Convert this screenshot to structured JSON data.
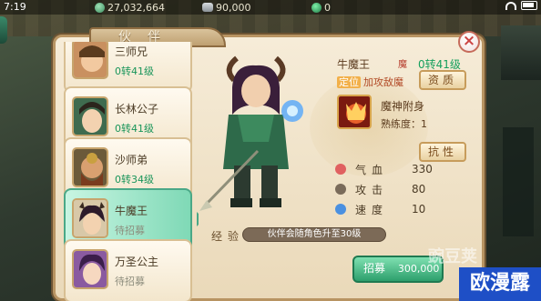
{
  "status_bar": {
    "time": "7:19",
    "gold": "27,032,664",
    "silver": "90,000",
    "jade": "0"
  },
  "panel": {
    "title": "伙伴",
    "close_label": "×"
  },
  "partners": [
    {
      "name": "三师兄",
      "status": "0转41级",
      "recruited": true
    },
    {
      "name": "长林公子",
      "status": "0转41级",
      "recruited": true
    },
    {
      "name": "沙师弟",
      "status": "0转34级",
      "recruited": true
    },
    {
      "name": "牛魔王",
      "status": "待招募",
      "recruited": false,
      "selected": true
    },
    {
      "name": "万圣公主",
      "status": "待招募",
      "recruited": false
    }
  ],
  "detail": {
    "name": "牛魔王",
    "name_icon": "魔",
    "level": "0转41级",
    "role_tag": "定位",
    "role": "加攻敌魔",
    "aptitude_button": "资质",
    "skill_name": "魔神附身",
    "skill_proficiency": "熟练度：1",
    "resist_button": "抗性",
    "stats": [
      {
        "label": "气血",
        "value": "330",
        "color": "#e06060"
      },
      {
        "label": "攻击",
        "value": "80",
        "color": "#7a6b5a"
      },
      {
        "label": "速度",
        "value": "10",
        "color": "#4a90e0"
      }
    ],
    "exp_label": "经验",
    "exp_text": "伙伴会随角色升至30级",
    "recruit_button": "招募",
    "recruit_cost": "300,000"
  },
  "watermark": {
    "logo": "豌豆荚",
    "box": "欧漫露"
  },
  "colors": {
    "panel_bg": "#f1e4c8",
    "accent_green": "#2d9f6c",
    "selected_card": "#7fd9b6"
  }
}
